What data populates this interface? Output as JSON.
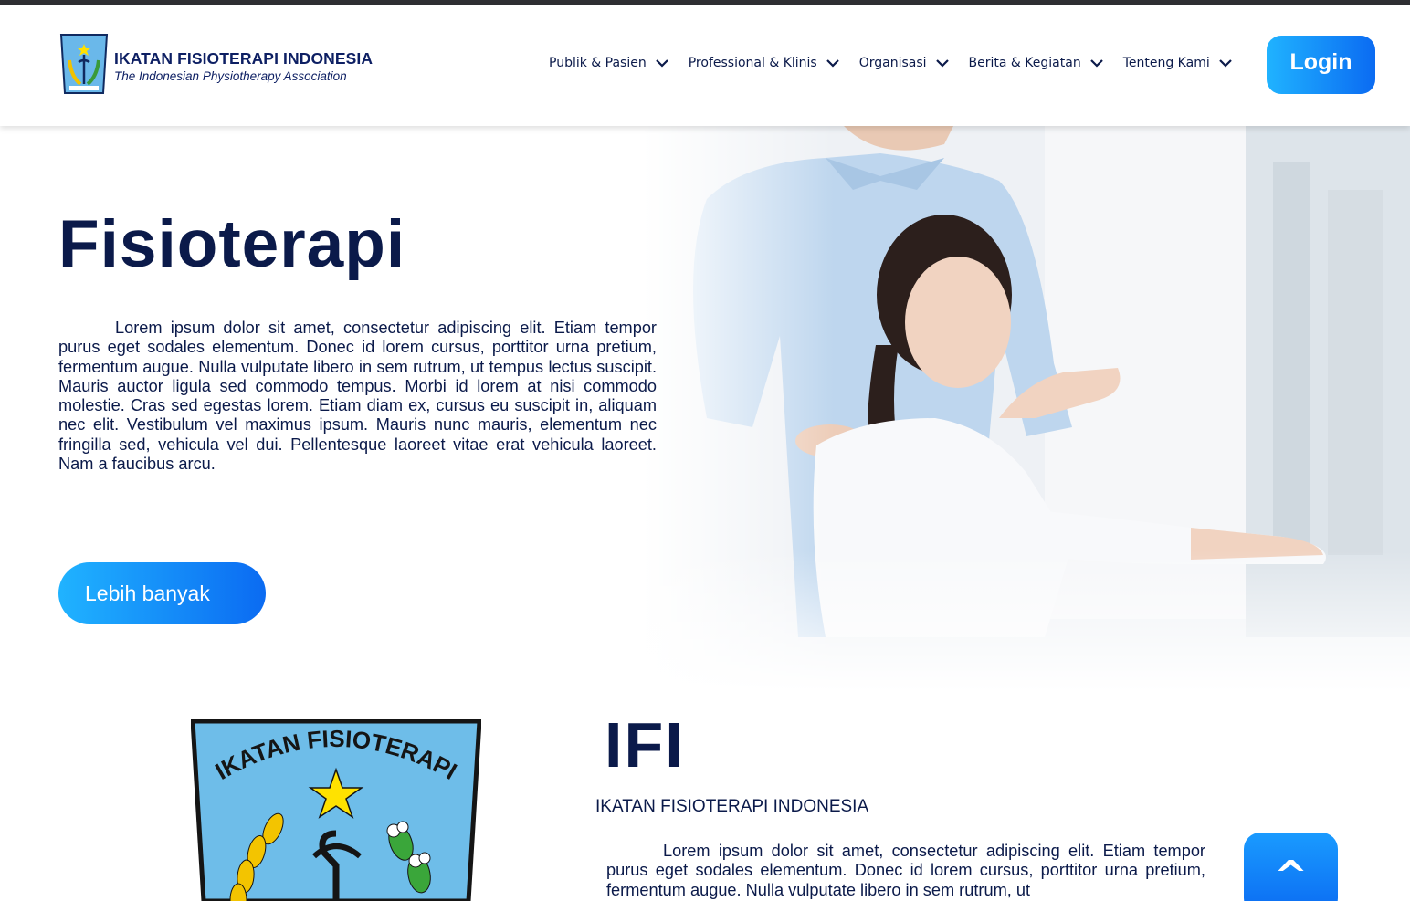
{
  "header": {
    "brand_title": "IKATAN FISIOTERAPI INDONESIA",
    "brand_subtitle": "The Indonesian Physiotherapy Association",
    "nav": [
      {
        "label": "Publik & Pasien"
      },
      {
        "label": "Professional & Klinis"
      },
      {
        "label": "Organisasi"
      },
      {
        "label": "Berita & Kegiatan"
      },
      {
        "label": "Tenteng Kami"
      }
    ],
    "login_label": "Login"
  },
  "hero": {
    "title": "Fisioterapi",
    "body": "Lorem ipsum dolor sit amet, consectetur adipiscing elit. Etiam tempor purus eget sodales elementum. Donec id lorem cursus, porttitor urna pretium, fermentum augue. Nulla vulputate libero in sem rutrum, ut tempus lectus suscipit. Mauris auctor ligula sed commodo tempus. Morbi id lorem at nisi commodo molestie. Cras sed egestas lorem. Etiam diam ex, cursus eu suscipit in, aliquam nec elit. Vestibulum vel maximus ipsum. Mauris nunc mauris, elementum nec fringilla sed, vehicula vel dui. Pellentesque laoreet vitae erat vehicula laoreet. Nam a faucibus arcu.",
    "button_label": "Lebih banyak"
  },
  "about": {
    "emblem_text": "IKATAN FISIOTERAPI",
    "title": "IFI",
    "subtitle": "IKATAN FISIOTERAPI INDONESIA",
    "body": "Lorem ipsum dolor sit amet, consectetur adipiscing elit. Etiam tempor purus eget sodales elementum. Donec id lorem cursus, porttitor urna pretium, fermentum augue. Nulla vulputate libero in sem rutrum, ut"
  },
  "scroll_top": {
    "label": "^"
  },
  "colors": {
    "navy": "#0b1a4a",
    "accent_start": "#20b3ff",
    "accent_end": "#0b6bf2"
  }
}
